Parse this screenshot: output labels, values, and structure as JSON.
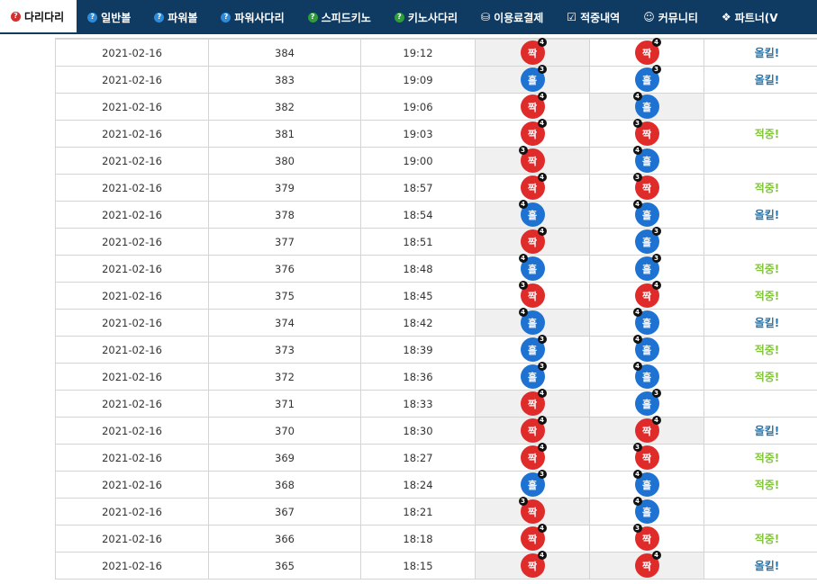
{
  "nav": [
    {
      "label": "다리다리",
      "icon": "question-red-icon",
      "active": true
    },
    {
      "label": "일반볼",
      "icon": "question-blue-icon",
      "active": false
    },
    {
      "label": "파워볼",
      "icon": "question-blue-icon",
      "active": false
    },
    {
      "label": "파워사다리",
      "icon": "question-blue-icon",
      "active": false
    },
    {
      "label": "스피드키노",
      "icon": "question-green-icon",
      "active": false
    },
    {
      "label": "키노사다리",
      "icon": "question-green-icon",
      "active": false
    },
    {
      "label": "이용료결제",
      "icon": "database-icon",
      "active": false
    },
    {
      "label": "적중내역",
      "icon": "checkbox-icon",
      "active": false
    },
    {
      "label": "커뮤니티",
      "icon": "smiley-icon",
      "active": false
    },
    {
      "label": "파트너(V",
      "icon": "cubes-icon",
      "active": false
    }
  ],
  "colors": {
    "nav_bg": "#0f3a62",
    "red": "#e02b2b",
    "blue": "#1e73d2",
    "hit": "#84c441",
    "allkill": "#2a75a9"
  },
  "rows": [
    {
      "date": "2021-02-16",
      "round": "384",
      "time": "19:12",
      "a": {
        "t": "짝",
        "n": "4",
        "c": "red",
        "side": "right",
        "bg": true
      },
      "b": {
        "t": "짝",
        "n": "4",
        "c": "red",
        "side": "right",
        "bg": false
      },
      "result": "올킬!",
      "rc": "all"
    },
    {
      "date": "2021-02-16",
      "round": "383",
      "time": "19:09",
      "a": {
        "t": "홀",
        "n": "3",
        "c": "blue",
        "side": "right",
        "bg": true
      },
      "b": {
        "t": "홀",
        "n": "3",
        "c": "blue",
        "side": "right",
        "bg": false
      },
      "result": "올킬!",
      "rc": "all"
    },
    {
      "date": "2021-02-16",
      "round": "382",
      "time": "19:06",
      "a": {
        "t": "짝",
        "n": "4",
        "c": "red",
        "side": "right",
        "bg": false
      },
      "b": {
        "t": "홀",
        "n": "4",
        "c": "blue",
        "side": "left",
        "bg": true
      },
      "result": "",
      "rc": ""
    },
    {
      "date": "2021-02-16",
      "round": "381",
      "time": "19:03",
      "a": {
        "t": "짝",
        "n": "4",
        "c": "red",
        "side": "right",
        "bg": false
      },
      "b": {
        "t": "짝",
        "n": "3",
        "c": "red",
        "side": "left",
        "bg": false
      },
      "result": "적중!",
      "rc": "win"
    },
    {
      "date": "2021-02-16",
      "round": "380",
      "time": "19:00",
      "a": {
        "t": "짝",
        "n": "3",
        "c": "red",
        "side": "left",
        "bg": true
      },
      "b": {
        "t": "홀",
        "n": "4",
        "c": "blue",
        "side": "left",
        "bg": false
      },
      "result": "",
      "rc": ""
    },
    {
      "date": "2021-02-16",
      "round": "379",
      "time": "18:57",
      "a": {
        "t": "짝",
        "n": "4",
        "c": "red",
        "side": "right",
        "bg": false
      },
      "b": {
        "t": "짝",
        "n": "3",
        "c": "red",
        "side": "left",
        "bg": false
      },
      "result": "적중!",
      "rc": "win"
    },
    {
      "date": "2021-02-16",
      "round": "378",
      "time": "18:54",
      "a": {
        "t": "홀",
        "n": "4",
        "c": "blue",
        "side": "left",
        "bg": true
      },
      "b": {
        "t": "홀",
        "n": "4",
        "c": "blue",
        "side": "left",
        "bg": false
      },
      "result": "올킬!",
      "rc": "all"
    },
    {
      "date": "2021-02-16",
      "round": "377",
      "time": "18:51",
      "a": {
        "t": "짝",
        "n": "4",
        "c": "red",
        "side": "right",
        "bg": true
      },
      "b": {
        "t": "홀",
        "n": "3",
        "c": "blue",
        "side": "right",
        "bg": false
      },
      "result": "",
      "rc": ""
    },
    {
      "date": "2021-02-16",
      "round": "376",
      "time": "18:48",
      "a": {
        "t": "홀",
        "n": "4",
        "c": "blue",
        "side": "left",
        "bg": false
      },
      "b": {
        "t": "홀",
        "n": "3",
        "c": "blue",
        "side": "right",
        "bg": false
      },
      "result": "적중!",
      "rc": "win"
    },
    {
      "date": "2021-02-16",
      "round": "375",
      "time": "18:45",
      "a": {
        "t": "짝",
        "n": "3",
        "c": "red",
        "side": "left",
        "bg": false
      },
      "b": {
        "t": "짝",
        "n": "4",
        "c": "red",
        "side": "right",
        "bg": false
      },
      "result": "적중!",
      "rc": "win"
    },
    {
      "date": "2021-02-16",
      "round": "374",
      "time": "18:42",
      "a": {
        "t": "홀",
        "n": "4",
        "c": "blue",
        "side": "left",
        "bg": true
      },
      "b": {
        "t": "홀",
        "n": "4",
        "c": "blue",
        "side": "left",
        "bg": false
      },
      "result": "올킬!",
      "rc": "all"
    },
    {
      "date": "2021-02-16",
      "round": "373",
      "time": "18:39",
      "a": {
        "t": "홀",
        "n": "3",
        "c": "blue",
        "side": "right",
        "bg": false
      },
      "b": {
        "t": "홀",
        "n": "4",
        "c": "blue",
        "side": "left",
        "bg": false
      },
      "result": "적중!",
      "rc": "win"
    },
    {
      "date": "2021-02-16",
      "round": "372",
      "time": "18:36",
      "a": {
        "t": "홀",
        "n": "3",
        "c": "blue",
        "side": "right",
        "bg": false
      },
      "b": {
        "t": "홀",
        "n": "4",
        "c": "blue",
        "side": "left",
        "bg": false
      },
      "result": "적중!",
      "rc": "win"
    },
    {
      "date": "2021-02-16",
      "round": "371",
      "time": "18:33",
      "a": {
        "t": "짝",
        "n": "4",
        "c": "red",
        "side": "right",
        "bg": true
      },
      "b": {
        "t": "홀",
        "n": "3",
        "c": "blue",
        "side": "right",
        "bg": false
      },
      "result": "",
      "rc": ""
    },
    {
      "date": "2021-02-16",
      "round": "370",
      "time": "18:30",
      "a": {
        "t": "짝",
        "n": "4",
        "c": "red",
        "side": "right",
        "bg": true
      },
      "b": {
        "t": "짝",
        "n": "4",
        "c": "red",
        "side": "right",
        "bg": true
      },
      "result": "올킬!",
      "rc": "all"
    },
    {
      "date": "2021-02-16",
      "round": "369",
      "time": "18:27",
      "a": {
        "t": "짝",
        "n": "4",
        "c": "red",
        "side": "right",
        "bg": false
      },
      "b": {
        "t": "짝",
        "n": "3",
        "c": "red",
        "side": "left",
        "bg": false
      },
      "result": "적중!",
      "rc": "win"
    },
    {
      "date": "2021-02-16",
      "round": "368",
      "time": "18:24",
      "a": {
        "t": "홀",
        "n": "3",
        "c": "blue",
        "side": "right",
        "bg": false
      },
      "b": {
        "t": "홀",
        "n": "4",
        "c": "blue",
        "side": "left",
        "bg": false
      },
      "result": "적중!",
      "rc": "win"
    },
    {
      "date": "2021-02-16",
      "round": "367",
      "time": "18:21",
      "a": {
        "t": "짝",
        "n": "3",
        "c": "red",
        "side": "left",
        "bg": true
      },
      "b": {
        "t": "홀",
        "n": "4",
        "c": "blue",
        "side": "left",
        "bg": false
      },
      "result": "",
      "rc": ""
    },
    {
      "date": "2021-02-16",
      "round": "366",
      "time": "18:18",
      "a": {
        "t": "짝",
        "n": "4",
        "c": "red",
        "side": "right",
        "bg": false
      },
      "b": {
        "t": "짝",
        "n": "3",
        "c": "red",
        "side": "left",
        "bg": false
      },
      "result": "적중!",
      "rc": "win"
    },
    {
      "date": "2021-02-16",
      "round": "365",
      "time": "18:15",
      "a": {
        "t": "짝",
        "n": "4",
        "c": "red",
        "side": "right",
        "bg": true
      },
      "b": {
        "t": "짝",
        "n": "4",
        "c": "red",
        "side": "right",
        "bg": true
      },
      "result": "올킬!",
      "rc": "all"
    }
  ]
}
